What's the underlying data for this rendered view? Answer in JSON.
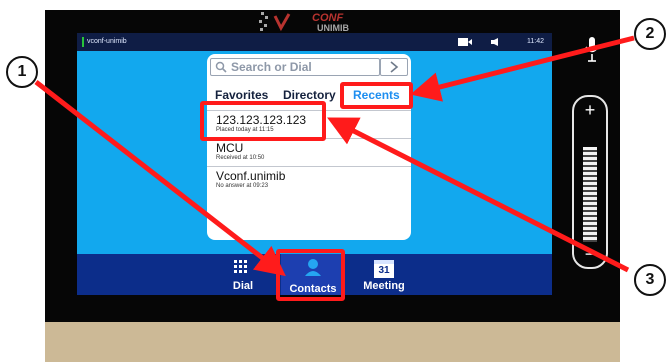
{
  "status": {
    "title": "vconf-unimib",
    "time": "11:42",
    "icons": [
      "camera-icon",
      "speaker-icon",
      "microphone-icon"
    ]
  },
  "search": {
    "placeholder": "Search or Dial"
  },
  "tabs": [
    {
      "label": "Favorites"
    },
    {
      "label": "Directory"
    },
    {
      "label": "Recents",
      "selected": true
    }
  ],
  "recents": [
    {
      "name": "123.123.123.123",
      "sub": "Placed today at 11:15"
    },
    {
      "name": "MCU",
      "sub": "Received at 10:50"
    },
    {
      "name": "Vconf.unimib",
      "sub": "No answer at 09:23"
    }
  ],
  "bottom_nav": [
    {
      "label": "Dial"
    },
    {
      "label": "Contacts",
      "active": true
    },
    {
      "label": "Meeting",
      "badge": "31"
    }
  ],
  "footer": {
    "logo_line1": "CONF",
    "logo_line2": "UNIMIB"
  },
  "callouts": [
    "1",
    "2",
    "3"
  ],
  "colors": {
    "screen_blue": "#12a8ee",
    "nav_blue": "#0c2d8a",
    "highlight_red": "#ff1b1b",
    "recents_blue": "#1d8ef0"
  }
}
